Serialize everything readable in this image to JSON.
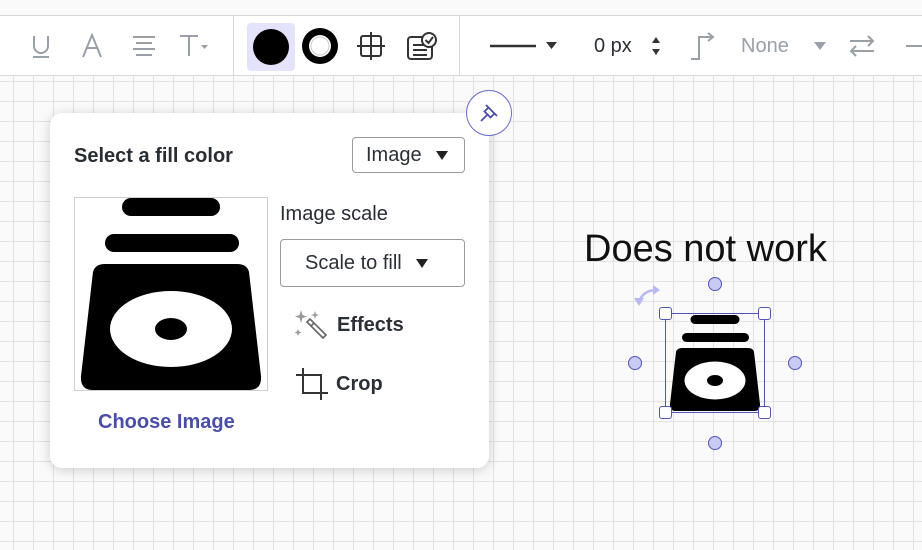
{
  "toolbar": {
    "stroke_width": "0 px",
    "arrow_end": "None"
  },
  "fill_panel": {
    "title": "Select a fill color",
    "fill_type": "Image",
    "image_scale_label": "Image scale",
    "scale_option": "Scale to fill",
    "effects_label": "Effects",
    "crop_label": "Crop",
    "choose_image": "Choose Image"
  },
  "canvas": {
    "text": "Does not work"
  },
  "colors": {
    "accent": "#4b4ea8",
    "selection": "#5055b8",
    "active_tool_bg": "#e3e4fb"
  }
}
